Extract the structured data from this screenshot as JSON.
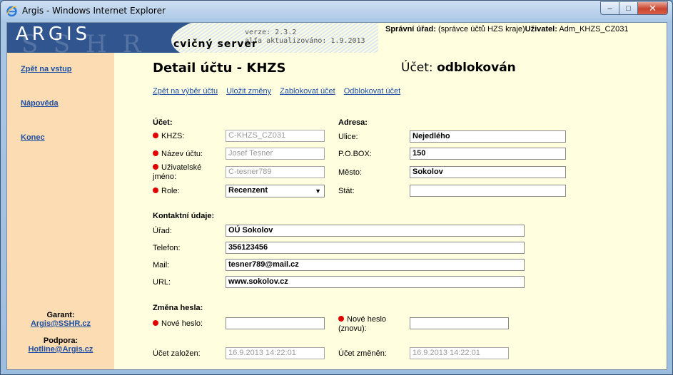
{
  "window": {
    "title": "Argis - Windows Internet Explorer",
    "buttons": {
      "minimize": "–",
      "maximize": "□",
      "close": "✕"
    }
  },
  "banner": {
    "logo": "ARGIS",
    "watermark": "SSHR",
    "server": "cvičný server",
    "version": "verze: 2.3.2",
    "updated": "alfa aktualizováno: 1.9.2013",
    "office_label": "Správní úřad:",
    "office_value": "(správce účtů HZS kraje)",
    "user_label": "Uživatel:",
    "user_value": "Adm_KHZS_CZ031"
  },
  "sidebar": {
    "links": [
      "Zpět na vstup",
      "Nápověda",
      "Konec"
    ],
    "guarantor_label": "Garant:",
    "guarantor_link": "Argis@SSHR.cz",
    "support_label": "Podpora:",
    "support_link": "Hotline@Argis.cz"
  },
  "main": {
    "title": "Detail účtu - KHZS",
    "status_label": "Účet:",
    "status_value": "odblokován",
    "actions": [
      "Zpět na výběr účtu",
      "Uložit změny",
      "Zablokovat účet",
      "Odblokovat účet"
    ]
  },
  "account": {
    "heading": "Účet:",
    "khzs_label": "KHZS:",
    "khzs_value": "C-KHZS_CZ031",
    "name_label": "Název účtu:",
    "name_value": "Josef Tesner",
    "username_label": "Uživatelské jméno:",
    "username_value": "C-tesner789",
    "role_label": "Role:",
    "role_value": "Recenzent"
  },
  "address": {
    "heading": "Adresa:",
    "street_label": "Ulice:",
    "street_value": "Nejedlého",
    "pobox_label": "P.O.BOX:",
    "pobox_value": "150",
    "city_label": "Město:",
    "city_value": "Sokolov",
    "state_label": "Stát:",
    "state_value": ""
  },
  "contact": {
    "heading": "Kontaktní údaje:",
    "office_label": "Úřad:",
    "office_value": "OÚ Sokolov",
    "phone_label": "Telefon:",
    "phone_value": "356123456",
    "mail_label": "Mail:",
    "mail_value": "tesner789@mail.cz",
    "url_label": "URL:",
    "url_value": "www.sokolov.cz"
  },
  "password": {
    "heading": "Změna hesla:",
    "new_label": "Nové heslo:",
    "new_value": "",
    "repeat_label": "Nové heslo (znovu):",
    "repeat_value": ""
  },
  "dates": {
    "created_label": "Účet založen:",
    "created_value": "16.9.2013 14:22:01",
    "changed_label": "Účet změněn:",
    "changed_value": "16.9.2013 14:22:01"
  }
}
